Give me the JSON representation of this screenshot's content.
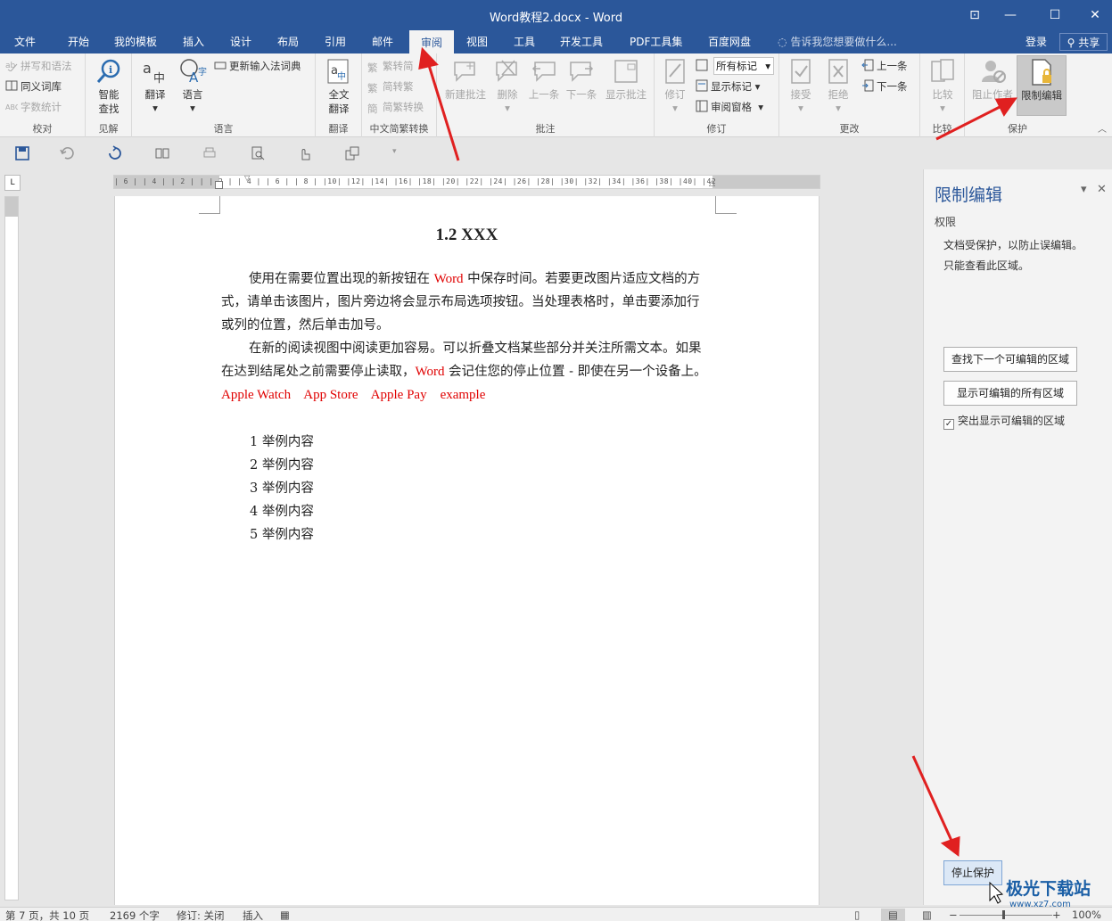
{
  "window": {
    "title": "Word教程2.docx - Word",
    "controls": [
      "⊡",
      "—",
      "☐",
      "✕"
    ]
  },
  "tabs": [
    "文件",
    "开始",
    "我的模板",
    "插入",
    "设计",
    "布局",
    "引用",
    "邮件",
    "审阅",
    "视图",
    "工具",
    "开发工具",
    "PDF工具集",
    "百度网盘"
  ],
  "active_tab": "审阅",
  "tell_me": "告诉我您想要做什么...",
  "login": "登录",
  "share": "共享",
  "ribbon": {
    "proofing": {
      "spell": "拼写和语法",
      "thesaurus": "同义词库",
      "wordcount": "字数统计",
      "label": "校对"
    },
    "insights": {
      "smart_lookup": [
        "智能",
        "查找"
      ],
      "label": "见解"
    },
    "language": {
      "translate": "翻译",
      "language": "语言",
      "update_ime": "更新输入法词典",
      "label": "语言"
    },
    "translation": {
      "full_text": [
        "全文",
        "翻译"
      ],
      "label": "翻译"
    },
    "chinese_conv": {
      "to_simplified": "繁转简",
      "to_traditional": "简转繁",
      "convert": "简繁转换",
      "label": "中文简繁转换"
    },
    "comments": {
      "new": "新建批注",
      "delete": "删除",
      "prev": "上一条",
      "next": "下一条",
      "show": "显示批注",
      "label": "批注"
    },
    "tracking": {
      "track": "修订",
      "markup": "所有标记",
      "show_markup": "显示标记",
      "pane": "审阅窗格",
      "label": "修订"
    },
    "changes": {
      "accept": "接受",
      "reject": "拒绝",
      "prev": "上一条",
      "next": "下一条",
      "label": "更改"
    },
    "compare": {
      "compare": "比较",
      "label": "比较"
    },
    "protect": {
      "block": "阻止作者",
      "restrict": "限制编辑",
      "label": "保护"
    }
  },
  "ruler_ticks": "| 6 |  | 4 |  | 2 |  |  | 2 |  | 4 |  | 6 |  | 8 |  |10|  |12|  |14|  |16|  |18|  |20|  |22|  |24|  |26|  |28|  |30|  |32|  |34|  |36|  |38|  |40|  |42",
  "ruler_corner": "L",
  "document": {
    "heading": "1.2 XXX",
    "p1_a": "使用在需要位置出现的新按钮在 ",
    "p1_word": "Word",
    "p1_b": " 中保存时间。若要更改图片适应文档的方式，请单击该图片，图片旁边将会显示布局选项按钮。当处理表格时，单击要添加行或列的位置，然后单击加号。",
    "p2_a": "在新的阅读视图中阅读更加容易。可以折叠文档某些部分并关注所需文本。如果在达到结尾处之前需要停止读取，",
    "p2_word": "Word",
    "p2_b": " 会记住您的停止位置 - 即使在另一个设备上。",
    "p2_red": "Apple Watch    App Store    Apple Pay    example",
    "list": [
      "1 举例内容",
      "2 举例内容",
      "3 举例内容",
      "4 举例内容",
      "5 举例内容"
    ]
  },
  "pane": {
    "title": "限制编辑",
    "section": "权限",
    "line1": "文档受保护，以防止误编辑。",
    "line2": "只能查看此区域。",
    "find_next": "查找下一个可编辑的区域",
    "show_all": "显示可编辑的所有区域",
    "highlight": "突出显示可编辑的区域",
    "highlight_checked": true,
    "stop": "停止保护"
  },
  "status": {
    "page": "第 7 页，共 10 页",
    "words": "2169 个字",
    "track": "修订: 关闭",
    "insert": "插入",
    "zoom": "100%"
  },
  "watermark": {
    "name": "极光下载站",
    "url": "www.xz7.com"
  },
  "colors": {
    "accent": "#2b579a",
    "arrow": "#e02020",
    "red_text": "#e00000"
  }
}
